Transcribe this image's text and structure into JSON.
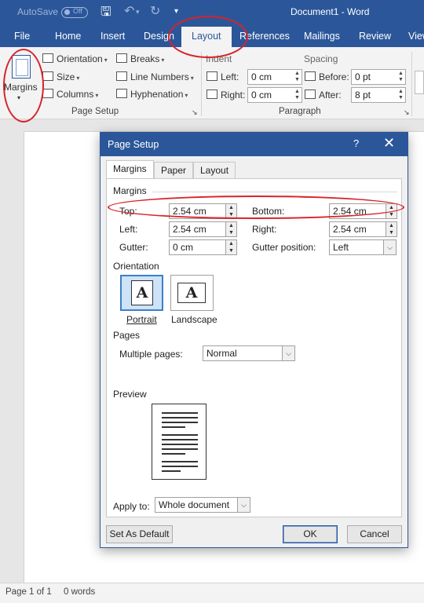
{
  "titlebar": {
    "autosave_label": "AutoSave",
    "autosave_toggle": "Off",
    "doc_title": "Document1 - Word",
    "qat_save_icon": "save-icon",
    "qat_undo_icon": "undo-icon",
    "qat_redo_icon": "redo-icon"
  },
  "tabs": [
    {
      "label": "File"
    },
    {
      "label": "Home"
    },
    {
      "label": "Insert"
    },
    {
      "label": "Design"
    },
    {
      "label": "Layout"
    },
    {
      "label": "References"
    },
    {
      "label": "Mailings"
    },
    {
      "label": "Review"
    },
    {
      "label": "View"
    }
  ],
  "active_tab": "Layout",
  "ribbon": {
    "page_setup": {
      "margins_label": "Margins",
      "orientation_label": "Orientation",
      "size_label": "Size",
      "columns_label": "Columns",
      "breaks_label": "Breaks",
      "line_numbers_label": "Line Numbers",
      "hyphenation_label": "Hyphenation",
      "group_label": "Page Setup"
    },
    "paragraph": {
      "indent_label": "Indent",
      "indent_left_label": "Left:",
      "indent_left_value": "0 cm",
      "indent_right_label": "Right:",
      "indent_right_value": "0 cm",
      "spacing_label": "Spacing",
      "spacing_before_label": "Before:",
      "spacing_before_value": "0 pt",
      "spacing_after_label": "After:",
      "spacing_after_value": "8 pt",
      "group_label": "Paragraph"
    }
  },
  "dialog": {
    "title": "Page Setup",
    "help": "?",
    "close": "✕",
    "tabs": [
      {
        "label": "Margins"
      },
      {
        "label": "Paper"
      },
      {
        "label": "Layout"
      }
    ],
    "margins_section": "Margins",
    "top_label": "Top:",
    "top_value": "2.54 cm",
    "bottom_label": "Bottom:",
    "bottom_value": "2.54 cm",
    "left_label": "Left:",
    "left_value": "2.54 cm",
    "right_label": "Right:",
    "right_value": "2.54 cm",
    "gutter_label": "Gutter:",
    "gutter_value": "0 cm",
    "gutter_position_label": "Gutter position:",
    "gutter_position_value": "Left",
    "orientation_section": "Orientation",
    "portrait_label": "Portrait",
    "landscape_label": "Landscape",
    "pages_section": "Pages",
    "multiple_pages_label": "Multiple pages:",
    "multiple_pages_value": "Normal",
    "preview_section": "Preview",
    "apply_to_label": "Apply to:",
    "apply_to_value": "Whole document",
    "set_default_label": "Set As Default",
    "ok_label": "OK",
    "cancel_label": "Cancel"
  },
  "statusbar": {
    "page": "Page 1 of 1",
    "words": "0 words"
  },
  "annotation_color": "#d8232a",
  "accent_color": "#2b579a"
}
